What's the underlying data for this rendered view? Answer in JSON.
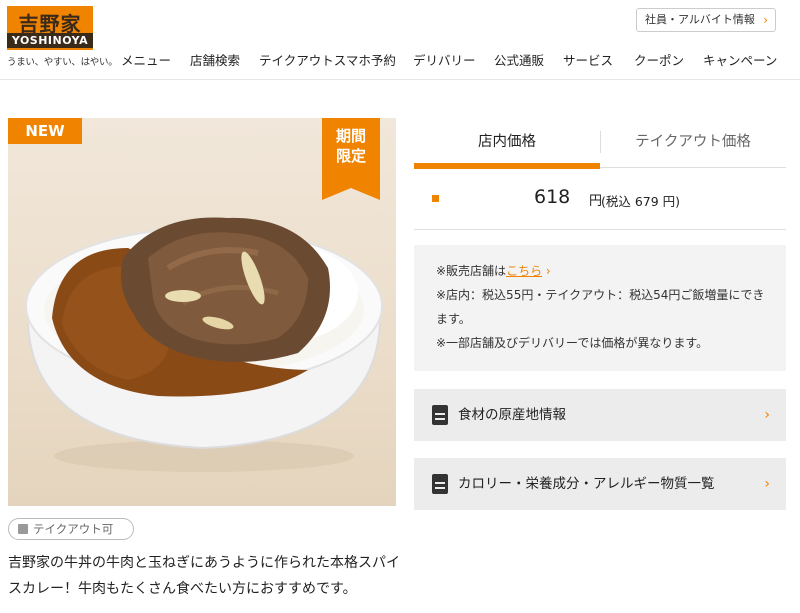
{
  "logo": {
    "kanji": "吉野家",
    "latin": "YOSHINOYA",
    "tagline": "うまい、やすい、はやい。"
  },
  "header": {
    "recruit_label": "社員・アルバイト情報",
    "nav": [
      "メニュー",
      "店舗検索",
      "テイクアウトスマホ予約",
      "デリバリー",
      "公式通販",
      "サービス",
      "クーポン",
      "キャンペーン"
    ]
  },
  "hero": {
    "badge_new": "NEW",
    "badge_limited_1": "期間",
    "badge_limited_2": "限定",
    "colors": {
      "accent": "#f08300"
    }
  },
  "takeout": {
    "label": "テイクアウト可"
  },
  "description": {
    "line1": "吉野家の牛丼の牛肉と玉ねぎにあうように作られた本格スパイ",
    "line2": "スカレー！牛肉もたくさん食べたい方におすすめです。"
  },
  "price_tabs": {
    "tab_store": "店内価格",
    "tab_takeout": "テイクアウト価格",
    "active": "店内価格"
  },
  "price": {
    "value": "618",
    "unit": "円",
    "tax_included": "(税込 679 円)"
  },
  "notes": {
    "line1_prefix": "※販売店舗は",
    "line1_link": "こちら",
    "line2": "※店内：税込55円・テイクアウト：税込54円ご飯増量にでき",
    "line3": "ます。",
    "line4": "※一部店舗及びデリバリーでは価格が異なります。"
  },
  "accordions": [
    {
      "label": "食材の原産地情報"
    },
    {
      "label": "カロリー・栄養成分・アレルギー物質一覧"
    }
  ]
}
